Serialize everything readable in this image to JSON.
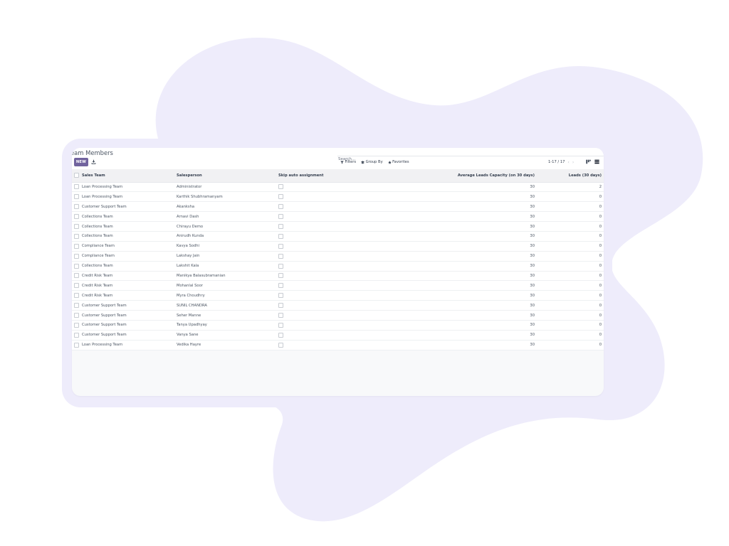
{
  "page": {
    "title": "eam Members",
    "search_placeholder": "Search...",
    "new_label": "NEW",
    "filters_label": "Filters",
    "groupby_label": "Group By",
    "favorites_label": "Favorites",
    "pager_label": "1-17 / 17",
    "accent_color": "#71639e"
  },
  "columns": {
    "team": "Sales Team",
    "salesperson": "Salesperson",
    "skip": "Skip auto assignment",
    "capacity": "Average Leads Capacity (on 30 days)",
    "leads": "Leads (30 days)"
  },
  "rows": [
    {
      "team": "Loan Processing Team",
      "salesperson": "Administrator",
      "capacity": "30",
      "leads": "2"
    },
    {
      "team": "Loan Processing Team",
      "salesperson": "Karthik Shubhramanyam",
      "capacity": "30",
      "leads": "0"
    },
    {
      "team": "Customer Support Team",
      "salesperson": "Akanksha",
      "capacity": "30",
      "leads": "0"
    },
    {
      "team": "Collections Team",
      "salesperson": "Arnavi Dash",
      "capacity": "30",
      "leads": "0"
    },
    {
      "team": "Collections Team",
      "salesperson": "Chirayu Demo",
      "capacity": "30",
      "leads": "0"
    },
    {
      "team": "Collections Team",
      "salesperson": "Anirudh Kunda",
      "capacity": "30",
      "leads": "0"
    },
    {
      "team": "Compliance Team",
      "salesperson": "Kavya Sodhi",
      "capacity": "30",
      "leads": "0"
    },
    {
      "team": "Compliance Team",
      "salesperson": "Lakshay Jain",
      "capacity": "30",
      "leads": "0"
    },
    {
      "team": "Collections Team",
      "salesperson": "Lakshit Kala",
      "capacity": "30",
      "leads": "0"
    },
    {
      "team": "Credit Risk Team",
      "salesperson": "Manikya Balasubramanian",
      "capacity": "30",
      "leads": "0"
    },
    {
      "team": "Credit Risk Team",
      "salesperson": "Mohanlal Soor",
      "capacity": "30",
      "leads": "0"
    },
    {
      "team": "Credit Risk Team",
      "salesperson": "Myra Choudhry",
      "capacity": "30",
      "leads": "0"
    },
    {
      "team": "Customer Support Team",
      "salesperson": "SUNIL CHANDRA",
      "capacity": "30",
      "leads": "0"
    },
    {
      "team": "Customer Support Team",
      "salesperson": "Seher Manne",
      "capacity": "30",
      "leads": "0"
    },
    {
      "team": "Customer Support Team",
      "salesperson": "Tanya Upadhyay",
      "capacity": "30",
      "leads": "0"
    },
    {
      "team": "Customer Support Team",
      "salesperson": "Vanya Sane",
      "capacity": "30",
      "leads": "0"
    },
    {
      "team": "Loan Processing Team",
      "salesperson": "Vedika Hayre",
      "capacity": "30",
      "leads": "0"
    }
  ]
}
